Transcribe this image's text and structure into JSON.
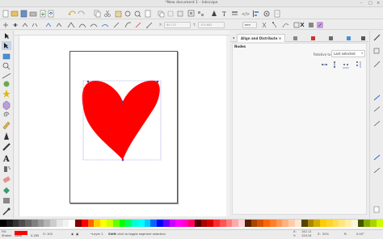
{
  "window": {
    "title": "*New document 1 - Inkscape"
  },
  "toolbar": {
    "icons": [
      "new-document-icon",
      "open-icon",
      "save-icon",
      "print-icon",
      "import-icon",
      "export-icon",
      "undo-icon",
      "redo-icon",
      "copy-icon",
      "cut-icon",
      "paste-icon",
      "zoom-selection-icon",
      "zoom-drawing-icon",
      "zoom-page-icon",
      "duplicate-icon",
      "clone-icon",
      "unlink-clone-icon",
      "group-icon",
      "ungroup-icon",
      "fill-stroke-icon",
      "text-font-icon",
      "layers-icon",
      "xml-editor-icon",
      "align-icon",
      "preferences-icon",
      "document-props-icon"
    ]
  },
  "tool_controls": {
    "x_label": "X:",
    "x_value": "89.713",
    "y_label": "Y:",
    "y_value": "105.683",
    "unit": "mm"
  },
  "dock": {
    "tab_label": "Align and Distribute",
    "section_title": "Nodes",
    "relative_label": "Relative to:",
    "relative_value": "Last selected"
  },
  "status": {
    "fill_label": "Fill:",
    "stroke_label": "Stroke:",
    "stroke_value": "None",
    "stroke_width": "0.265",
    "opacity_label": "O:",
    "opacity_value": "100",
    "layer_name": "•Layer 1",
    "hint_bold": "Shift",
    "hint_text": ": click to toggle segment selection",
    "x_coord_label": "X:",
    "x_coord": "142.11",
    "y_coord_label": "Y:",
    "y_coord": "120.24",
    "zoom_label": "Z:",
    "zoom": "52%",
    "rotation_label": "R:",
    "rotation": "0.00°"
  },
  "colors": {
    "heart_fill": "#ff0000",
    "fill_swatch": "#ff0000",
    "selection": "#7a7ad6"
  },
  "palette": [
    "#000000",
    "#1a1a1a",
    "#333333",
    "#4d4d4d",
    "#666666",
    "#808080",
    "#999999",
    "#b3b3b3",
    "#cccccc",
    "#e6e6e6",
    "#f2f2f2",
    "#ffffff",
    "#800000",
    "#ff0000",
    "#ff6600",
    "#ffcc00",
    "#ffff00",
    "#ccff00",
    "#66ff00",
    "#00ff00",
    "#00ff66",
    "#00ffcc",
    "#00ffff",
    "#00ccff",
    "#0066ff",
    "#0000ff",
    "#6600ff",
    "#cc00ff",
    "#ff00ff",
    "#ff00cc",
    "#ff0066",
    "#550000",
    "#aa0000",
    "#d40000",
    "#ff2a2a",
    "#ff5555",
    "#ff8080",
    "#ffaaaa",
    "#ffd5d5",
    "#552200",
    "#aa4400",
    "#d45500",
    "#ff6600",
    "#ff7f2a",
    "#ff9955",
    "#ffb380",
    "#ffccaa",
    "#ffe6d5",
    "#554400",
    "#aa8800",
    "#d4aa00",
    "#ffcc00",
    "#ffd42a",
    "#ffdd55",
    "#ffe680",
    "#ffeeaa",
    "#fff6d5",
    "#445500",
    "#88aa00",
    "#aad400",
    "#ccff00"
  ]
}
